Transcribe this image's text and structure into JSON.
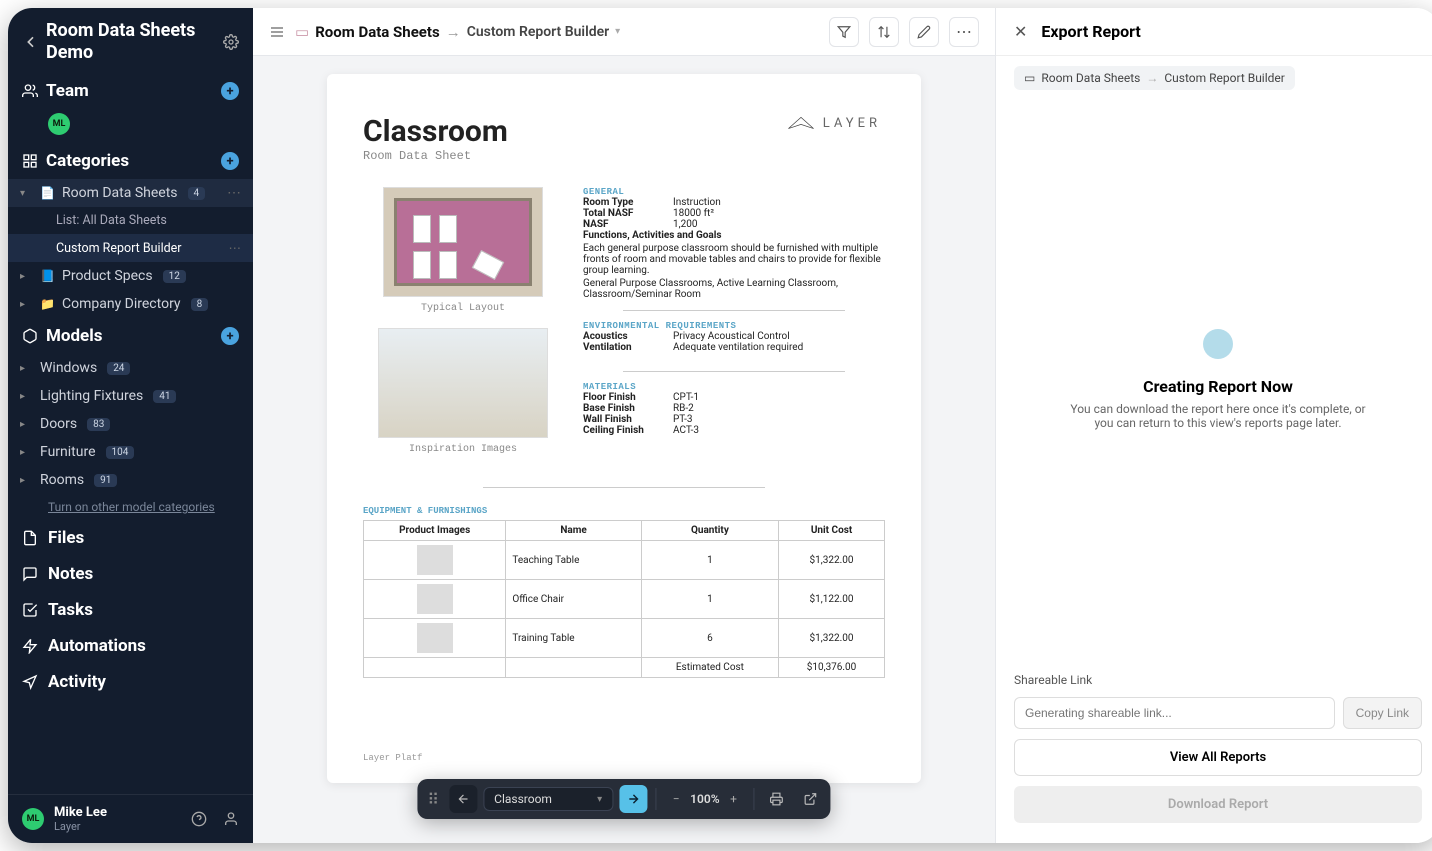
{
  "sidebar": {
    "title": "Room Data Sheets Demo",
    "sections": {
      "team": {
        "label": "Team",
        "avatar_initials": "ML"
      },
      "categories": {
        "label": "Categories",
        "items": [
          {
            "label": "Room Data Sheets",
            "count": "4",
            "icon": "📄",
            "expanded": true,
            "children": [
              {
                "label": "List: All Data Sheets"
              },
              {
                "label": "Custom Report Builder",
                "active": true
              }
            ]
          },
          {
            "label": "Product Specs",
            "count": "12",
            "icon": "📘"
          },
          {
            "label": "Company Directory",
            "count": "8",
            "icon": "📁"
          }
        ]
      },
      "models": {
        "label": "Models",
        "items": [
          {
            "label": "Windows",
            "count": "24"
          },
          {
            "label": "Lighting Fixtures",
            "count": "41"
          },
          {
            "label": "Doors",
            "count": "83"
          },
          {
            "label": "Furniture",
            "count": "104"
          },
          {
            "label": "Rooms",
            "count": "91"
          }
        ],
        "more_link": "Turn on other model categories"
      }
    },
    "nav": [
      {
        "label": "Files"
      },
      {
        "label": "Notes"
      },
      {
        "label": "Tasks"
      },
      {
        "label": "Automations"
      },
      {
        "label": "Activity"
      }
    ],
    "footer": {
      "name": "Mike Lee",
      "org": "Layer",
      "initials": "ML"
    }
  },
  "topbar": {
    "crumb1": "Room Data Sheets",
    "crumb2": "Custom Report Builder"
  },
  "document": {
    "title": "Classroom",
    "subtitle": "Room Data Sheet",
    "logo_text": "LAYER",
    "layout_caption": "Typical Layout",
    "inspiration_caption": "Inspiration Images",
    "sections": {
      "general": {
        "header": "GENERAL",
        "rows": [
          {
            "k": "Room Type",
            "v": "Instruction"
          },
          {
            "k": "Total NASF",
            "v": "18000 ft²"
          },
          {
            "k": "NASF",
            "v": "1,200"
          }
        ],
        "func_header": "Functions, Activities and Goals",
        "func_body": "Each general purpose classroom should be furnished with multiple fronts of room and movable tables and chairs to provide for flexible group learning.",
        "func_list": "General Purpose Classrooms, Active Learning Classroom, Classroom/Seminar Room"
      },
      "env": {
        "header": "ENVIRONMENTAL REQUIREMENTS",
        "rows": [
          {
            "k": "Acoustics",
            "v": "Privacy Acoustical Control"
          },
          {
            "k": "Ventilation",
            "v": "Adequate ventilation required"
          }
        ]
      },
      "materials": {
        "header": "MATERIALS",
        "rows": [
          {
            "k": "Floor Finish",
            "v": "CPT-1"
          },
          {
            "k": "Base Finish",
            "v": "RB-2"
          },
          {
            "k": "Wall Finish",
            "v": "PT-3"
          },
          {
            "k": "Ceiling Finish",
            "v": "ACT-3"
          }
        ]
      }
    },
    "equipment": {
      "header": "EQUIPMENT & FURNISHINGS",
      "columns": [
        "Product Images",
        "Name",
        "Quantity",
        "Unit Cost"
      ],
      "rows": [
        {
          "name": "Teaching Table",
          "qty": "1",
          "cost": "$1,322.00"
        },
        {
          "name": "Office Chair",
          "qty": "1",
          "cost": "$1,122.00"
        },
        {
          "name": "Training Table",
          "qty": "6",
          "cost": "$1,322.00"
        }
      ],
      "est_label": "Estimated Cost",
      "est_value": "$10,376.00"
    },
    "footer_text": "Layer Platf"
  },
  "bottombar": {
    "select": "Classroom",
    "zoom": "100%"
  },
  "rightpanel": {
    "title": "Export Report",
    "crumb1": "Room Data Sheets",
    "crumb2": "Custom Report Builder",
    "status_title": "Creating Report Now",
    "status_body": "You can download the report here once it's complete, or you can return to this view's reports page later.",
    "link_label": "Shareable Link",
    "link_placeholder": "Generating shareable link...",
    "copy_btn": "Copy Link",
    "viewall_btn": "View All Reports",
    "download_btn": "Download Report"
  }
}
